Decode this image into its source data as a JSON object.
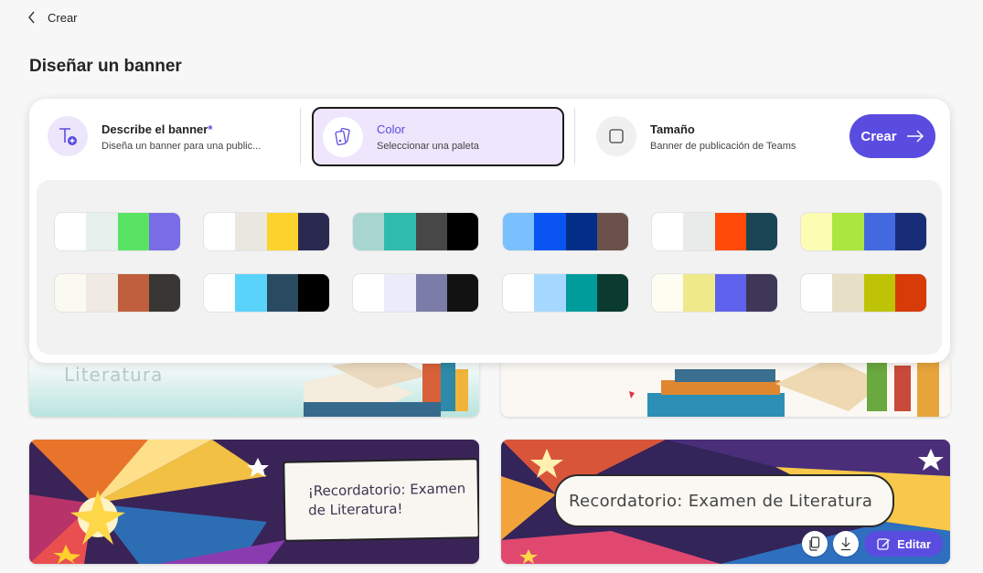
{
  "header": {
    "back_label": "Crear"
  },
  "page_title": "Diseñar un banner",
  "steps": [
    {
      "title": "Describe el banner",
      "required_mark": "*",
      "subtitle": "Diseña un banner para una public...",
      "icon": "text-add-icon"
    },
    {
      "title": "Color",
      "subtitle": "Seleccionar una paleta",
      "icon": "palette-card-icon",
      "active": true
    },
    {
      "title": "Tamaño",
      "subtitle": "Banner de publicación de Teams",
      "icon": "square-icon"
    }
  ],
  "create_button": {
    "label": "Crear"
  },
  "palettes": [
    [
      "#ffffff",
      "#e6f0ec",
      "#58e362",
      "#7a6ce6"
    ],
    [
      "#ffffff",
      "#eae7df",
      "#fbd32c",
      "#2a2950"
    ],
    [
      "#a7d6d0",
      "#2fbcac",
      "#474747",
      "#000000"
    ],
    [
      "#79c0ff",
      "#0a55f2",
      "#032e88",
      "#6a524b"
    ],
    [
      "#ffffff",
      "#e8ebea",
      "#ff4a0a",
      "#1a4555"
    ],
    [
      "#fcfcb3",
      "#abe63e",
      "#4369e0",
      "#182d78"
    ],
    [
      "#fbfaf1",
      "#efeae2",
      "#c05f3e",
      "#383734"
    ],
    [
      "#ffffff",
      "#5ad3fb",
      "#2a4a62",
      "#000000"
    ],
    [
      "#ffffff",
      "#ecebfa",
      "#7c7ca8",
      "#121212"
    ],
    [
      "#ffffff",
      "#a6d8ff",
      "#009b9b",
      "#0a3a30"
    ],
    [
      "#fefdf1",
      "#f0e98a",
      "#5f62ec",
      "#3e3758"
    ],
    [
      "#ffffff",
      "#e8dfc7",
      "#bec306",
      "#d83a08"
    ]
  ],
  "banners": {
    "b1_text": "Literatura",
    "b3_text": "¡Recordatorio: Examen de Literatura!",
    "b4_text": "Recordatorio: Examen de Literatura",
    "edit_label": "Editar"
  },
  "colors": {
    "accent": "#5b4ce0",
    "active_step_bg": "#ede6fd"
  }
}
